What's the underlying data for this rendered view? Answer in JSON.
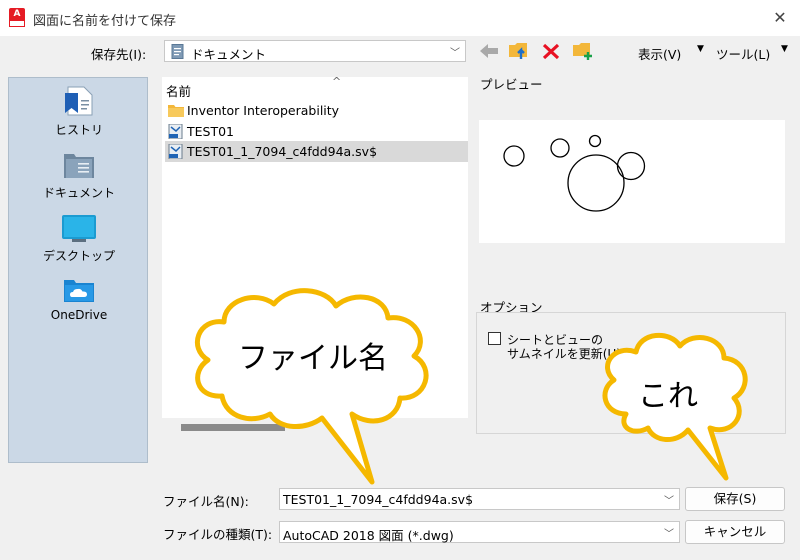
{
  "window": {
    "title": "図面に名前を付けて保存",
    "app_icon_letter": "A"
  },
  "save_in": {
    "label": "保存先(I):",
    "value": "ドキュメント"
  },
  "toolbar": {
    "view_label": "表示(V)",
    "tools_label": "ツール(L)"
  },
  "places": [
    {
      "label": "ヒストリ",
      "icon": "history-icon"
    },
    {
      "label": "ドキュメント",
      "icon": "documents-icon"
    },
    {
      "label": "デスクトップ",
      "icon": "desktop-icon"
    },
    {
      "label": "OneDrive",
      "icon": "onedrive-icon"
    }
  ],
  "file_list": {
    "column_header": "名前",
    "items": [
      {
        "name": "Inventor Interoperability",
        "type": "folder"
      },
      {
        "name": "TEST01",
        "type": "dwg"
      },
      {
        "name": "TEST01_1_7094_c4fdd94a.sv$",
        "type": "dwg",
        "selected": true
      }
    ]
  },
  "preview": {
    "label": "プレビュー"
  },
  "options": {
    "label": "オプション",
    "checkbox_line1": "シートとビューの",
    "checkbox_line2": "サムネイルを更新(U)",
    "checked": false
  },
  "file_name": {
    "label": "ファイル名(N):",
    "value": "TEST01_1_7094_c4fdd94a.sv$"
  },
  "file_type": {
    "label": "ファイルの種類(T):",
    "value": "AutoCAD 2018 図面 (*.dwg)"
  },
  "buttons": {
    "save": "保存(S)",
    "cancel": "キャンセル"
  },
  "annotations": {
    "filename_callout": "ファイル名",
    "save_callout": "これ"
  },
  "colors": {
    "callout_border": "#f5b800",
    "selected_row": "#d9d9d9",
    "places_bg": "#cbd8e6",
    "delete_red": "#e81123",
    "folder_yellow": "#f3b73a"
  }
}
